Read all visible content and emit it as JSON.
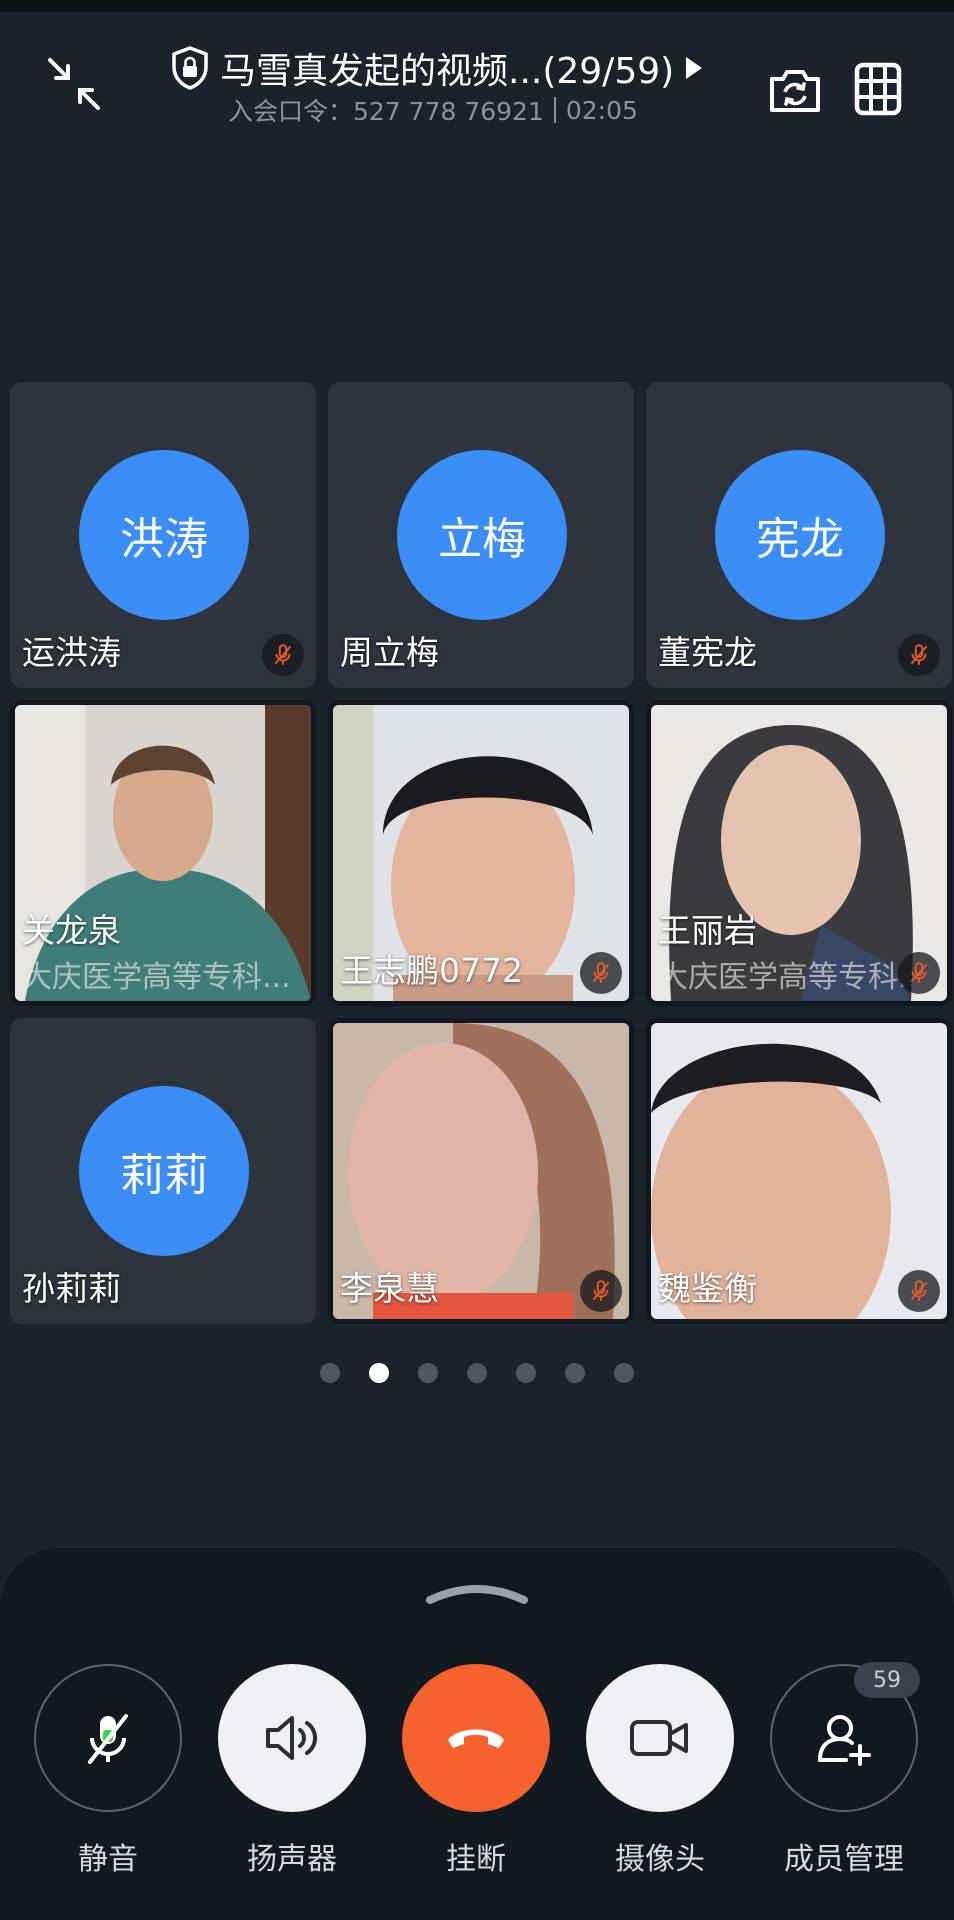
{
  "header": {
    "title": "马雪真发起的视频...(29/59)",
    "meeting_code": "入会口令：527 778 76921",
    "duration": "02:05"
  },
  "tiles": [
    {
      "name": "运洪涛",
      "avatar_text": "洪涛",
      "muted": true
    },
    {
      "name": "周立梅",
      "avatar_text": "立梅",
      "muted": false
    },
    {
      "name": "董宪龙",
      "avatar_text": "宪龙",
      "muted": true
    },
    {
      "name": "关龙泉",
      "org": "大庆医学高等专科...",
      "muted": false,
      "video": true
    },
    {
      "name": "王志鹏0772",
      "muted": true,
      "video": true
    },
    {
      "name": "王丽岩",
      "org": "大庆医学高等专科...",
      "muted": true,
      "video": true
    },
    {
      "name": "孙莉莉",
      "avatar_text": "莉莉",
      "muted": false
    },
    {
      "name": "李泉慧",
      "muted": true,
      "video": true
    },
    {
      "name": "魏鉴衡",
      "muted": true,
      "video": true
    }
  ],
  "pager": {
    "pages": 7,
    "active": 2
  },
  "controls": {
    "mute_label": "静音",
    "speaker_label": "扬声器",
    "hangup_label": "挂断",
    "camera_label": "摄像头",
    "members_label": "成员管理",
    "member_count": "59"
  },
  "colors": {
    "accent": "#3a8ef6",
    "hangup": "#f5622d",
    "background": "#1b222c",
    "mute_icon": "#e35a2c"
  }
}
